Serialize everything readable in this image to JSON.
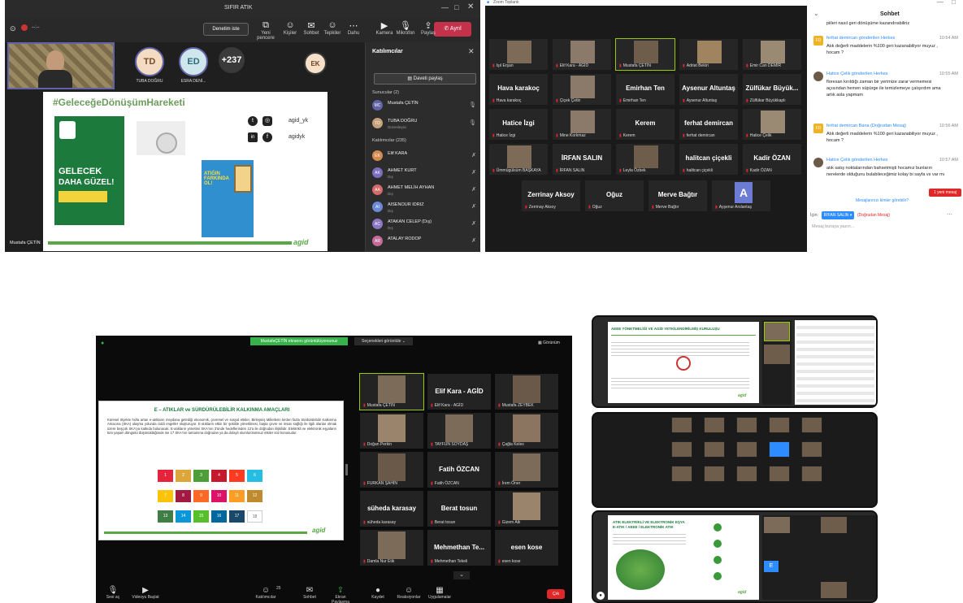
{
  "teams": {
    "title": "SIFIR ATIK",
    "meeting_btn": "Denetim iste",
    "toolbar": [
      {
        "label": "Yeni pencere",
        "icon": "window-icon"
      },
      {
        "label": "Kişiler",
        "icon": "people-icon"
      },
      {
        "label": "Sohbet",
        "icon": "chat-icon"
      },
      {
        "label": "Tepkiler",
        "icon": "reaction-icon"
      },
      {
        "label": "Dahu",
        "icon": "more-icon"
      },
      {
        "label": "Kamera",
        "icon": "camera-icon"
      },
      {
        "label": "Mikrofon",
        "icon": "mic-icon"
      },
      {
        "label": "Paylaş",
        "icon": "share-icon"
      }
    ],
    "leave_btn": "Ayrıl",
    "avatars": [
      {
        "initials": "TD",
        "name": "TUBA DOĞRU",
        "bg": "#f3dcc3",
        "fg": "#7a4a26"
      },
      {
        "initials": "ED",
        "name": "ESRA DENİ...",
        "bg": "#cfe7ec",
        "fg": "#2b6c7a"
      },
      {
        "initials": "+237",
        "name": "",
        "bg": "#3a3a3a",
        "fg": "#ffffff"
      },
      {
        "initials": "EK",
        "name": "",
        "bg": "#f6e0c8",
        "fg": "#6a4020"
      }
    ],
    "presenter_label": "Mustafa ÇETİN",
    "slide": {
      "hashtag": "#GeleceğeDönüşümHareketi",
      "poster_line1": "GELECEK",
      "poster_line2": "DAHA GÜZEL!",
      "social1": "agid_yk",
      "social2": "agidyk",
      "board_title": "ATIĞIN FARKINDA OL!",
      "logo": "agid"
    },
    "participants": {
      "header": "Katılımcılar",
      "invite": "Daveti paylaş",
      "presenters_label": "Sunucular (2)",
      "attendees_label": "Katılımcılar (235)",
      "presenters": [
        {
          "initials": "MC",
          "name": "Mustafa ÇETİN",
          "role": "",
          "color": "#6264a7"
        },
        {
          "initials": "TD",
          "name": "TUBA DOĞRU",
          "role": "Düzenleyici",
          "color": "#c7a17a"
        }
      ],
      "attendees": [
        {
          "initials": "EK",
          "name": "Elif KARA",
          "role": "",
          "color": "#d48a4f"
        },
        {
          "initials": "AK",
          "name": "AHMET KURT",
          "role": "Dış",
          "color": "#7a6fbf"
        },
        {
          "initials": "AA",
          "name": "AHMET MELİH AYHAN",
          "role": "Dış",
          "color": "#d46b6b"
        },
        {
          "initials": "AI",
          "name": "AISENOUR IDRIZ",
          "role": "Dış",
          "color": "#6b89d4"
        },
        {
          "initials": "AC",
          "name": "ATAKAN CELEP (Dış)",
          "role": "Dış",
          "color": "#8d77c4"
        },
        {
          "initials": "AR",
          "name": "ATALAY RODOP",
          "role": "",
          "color": "#c46b9a"
        }
      ]
    }
  },
  "zoom_gallery": {
    "window_title": "Zoom Toplantı",
    "tiles": [
      {
        "big": "",
        "label": "Işıl Erşan",
        "photo": true
      },
      {
        "big": "",
        "label": "Elif Kara - AGİD",
        "photo": true
      },
      {
        "big": "",
        "label": "Mustafa ÇETİN",
        "photo": true
      },
      {
        "big": "",
        "label": "Adriat Bekiri",
        "photo": true
      },
      {
        "big": "",
        "label": "Emir Can DEMİR",
        "photo": true
      },
      {
        "big": "Hava karakoç",
        "label": "Hava karakoç",
        "photo": false
      },
      {
        "big": "",
        "label": "Çiçek Çetin",
        "photo": true
      },
      {
        "big": "Emirhan Ten",
        "label": "Emirhan Ten",
        "photo": false
      },
      {
        "big": "Aysenur Altuntaş",
        "label": "Aysenur Altuntaş",
        "photo": false
      },
      {
        "big": "Zülfükar Büyük...",
        "label": "Zülfükar Büyükkaplı",
        "photo": false
      },
      {
        "big": "Hatice İzgi",
        "label": "Hatice İzgi",
        "photo": false
      },
      {
        "big": "",
        "label": "Mine Korkmaz",
        "photo": true
      },
      {
        "big": "Kerem",
        "label": "Kerem",
        "photo": false
      },
      {
        "big": "ferhat demircan",
        "label": "ferhat demircan",
        "photo": false
      },
      {
        "big": "",
        "label": "Hatice Çelik",
        "photo": true
      },
      {
        "big": "",
        "label": "Ümmügülsüm BAŞKAYA",
        "photo": true
      },
      {
        "big": "İRFAN SALIN",
        "label": "İRFAN SALIN",
        "photo": false
      },
      {
        "big": "",
        "label": "Leyla Özbek",
        "photo": true
      },
      {
        "big": "halitcan çiçekli",
        "label": "halitcan çiçekli",
        "photo": false
      },
      {
        "big": "Kadir ÖZAN",
        "label": "Kadir ÖZAN",
        "photo": false
      },
      {
        "big": "Zerrinay Aksoy",
        "label": "Zerrinay Aksoy",
        "photo": false
      },
      {
        "big": "Oğuz",
        "label": "Oğuz",
        "photo": false
      },
      {
        "big": "Merve Bağtır",
        "label": "Merve Bağtır",
        "photo": false
      },
      {
        "big": "A",
        "label": "Ayşenur Arslantaş",
        "photo": false
      }
    ]
  },
  "zoom_chat": {
    "title": "Sohbet",
    "top_line": "piileri nasıl geri dönüşüme kazandırabiliriz",
    "messages": [
      {
        "avatar": "FD",
        "from": "ferhat demircan gönderilen Herkes",
        "time": "10:54 AM",
        "text": "Atık değerli maddelerin %100 geri kazanabiliyor muyuz , hocam ?",
        "photo": false
      },
      {
        "avatar": "",
        "from": "Hatice Çelik gönderilen Herkes",
        "time": "10:55 AM",
        "text": "floresan kırıldığı zaman bir yerimize zarar vermemesi açısından hemen süpürge ile temizlemeye çalışırdım ama artık asla yapmam",
        "photo": true
      },
      {
        "avatar": "FD",
        "from": "ferhat demircan Bana (Doğrudan Mesaj)",
        "time": "10:56 AM",
        "text": "Atık değerli maddelerin %100 geri kazanabiliyor muyuz , hocam ?",
        "photo": false
      },
      {
        "avatar": "",
        "from": "Hatice Çelik gönderilen Herkes",
        "time": "10:57 AM",
        "text": "atık satış noktalarından bahsetmişti hocamız bunların nerelerde olduğunu bulabileceğimiz kolay bi sayfa vs var mı",
        "photo": true
      }
    ],
    "new_msg_badge": "1 yeni mesaj",
    "files_link": "Mesajlarınızı kimler görebilir?",
    "to_label": "İçin:",
    "to_value": "İRFAN SALIN",
    "direct_label": "(Doğrudan Mesaj)",
    "placeholder": "Mesaj buraya yazın..."
  },
  "zoom_share": {
    "banner": "MustafaÇETİN ekranını görüntülüyorsunuz",
    "view_options": "Seçenekleri görüntüle",
    "view_btn": "Görünüm",
    "slide_title": "E – ATIKLAR  ve SÜRDÜRÜLEBİLİR KALKINMA AMAÇLARI",
    "slide_text": "Küresel ölçekte hızla artan e-atıkların meydana getirdiği ekonomik, çevresel ve sosyal etkiler, Birleşmiş Milletlerin kirden fazla Sürdürülebilir Kalkınma Amacına (SKA) ulaşma yolunda ciddi engeller oluşturuyor. E-atıkların etkin bir şekilde yönetilmesi, başta çevre ve insan sağlığı ile ilgili olanlar olmak üzere beşçok SKA'ya katkıda bulunacak. E-atıkların yönetimi SKA'nın 3'ünde hedeflerinden 12'a ile doğrudan ilişkilidir. Elektrikli ve elektronik eşyaların tüm yaşam döngüsü düşünüldüğünde ise 17 SKA'nın tamamına doğrudan ya da dolaylı olumlu/olumsuz etkiler söz konusudur.",
    "logo": "agid",
    "tiles": [
      {
        "big": "",
        "label": "Mustafa ÇETİN",
        "photo": true
      },
      {
        "big": "Elif Kara - AGİD",
        "label": "Elif Kara - AGİD",
        "photo": false
      },
      {
        "big": "",
        "label": "Mustafa ZEYBEK",
        "photo": true
      },
      {
        "big": "",
        "label": "Doğan Perkin",
        "photo": true
      },
      {
        "big": "",
        "label": "TAYFUN SOYDAŞ",
        "photo": true
      },
      {
        "big": "",
        "label": "Çağla Keles",
        "photo": true
      },
      {
        "big": "",
        "label": "FURKAN ŞAHİN",
        "photo": true
      },
      {
        "big": "Fatih ÖZCAN",
        "label": "Fatih ÖZCAN",
        "photo": false
      },
      {
        "big": "",
        "label": "İrem Öner",
        "photo": true
      },
      {
        "big": "süheda karasay",
        "label": "süheda karasay",
        "photo": false
      },
      {
        "big": "Berat tosun",
        "label": "Berat tosun",
        "photo": false
      },
      {
        "big": "",
        "label": "Gizem Atlı",
        "photo": true
      },
      {
        "big": "",
        "label": "Damla Nur Etik",
        "photo": true
      },
      {
        "big": "Mehmethan Te...",
        "label": "Mehmethan Tekeli",
        "photo": false
      },
      {
        "big": "esen kose",
        "label": "esen kose",
        "photo": false
      }
    ],
    "bottom": [
      {
        "label": "Sesi aç",
        "icon": "mic-off-icon"
      },
      {
        "label": "Videoyu Başlat",
        "icon": "video-off-icon"
      },
      {
        "label": "Katılımcılar",
        "icon": "participants-icon"
      },
      {
        "label": "Sohbet",
        "icon": "chat-icon"
      },
      {
        "label": "Ekran Paylaşma",
        "icon": "share-screen-icon"
      },
      {
        "label": "Kaydet",
        "icon": "record-icon"
      },
      {
        "label": "Reaksiyonlar",
        "icon": "reactions-icon"
      },
      {
        "label": "Uygulamalar",
        "icon": "apps-icon"
      }
    ],
    "participant_count": "25",
    "end_btn": "Çık"
  },
  "stack": {
    "top_title": "AEEE YÖNETMELİĞİ VE AGİD YETKİLENDİRİLMİŞ KURULUŞU",
    "bottom_title": "ATIK ELEKTRİKLİ VE ELEKTRONİK EŞYA\nE-ATIK / AEEE / ELEKTRONİK ATIK",
    "logo": "agid"
  }
}
